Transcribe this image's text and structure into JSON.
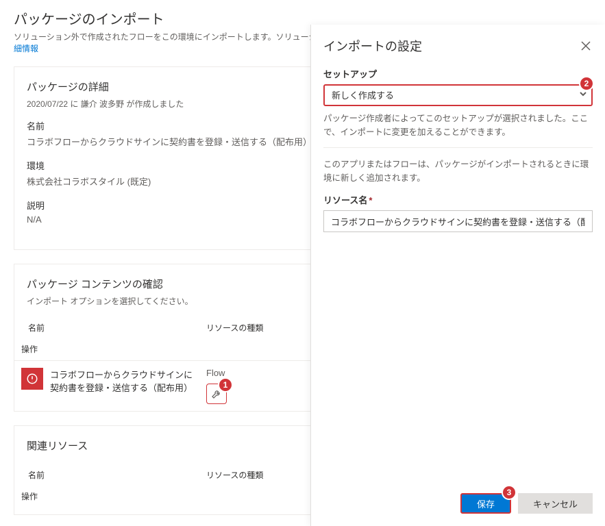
{
  "page": {
    "title": "パッケージのインポート",
    "subtitle_prefix": "ソリューション外で作成されたフローをこの環境にインポートします。ソリューションで作成されたフローは、ソリューションとしてインポートできます。",
    "subtitle_link": "詳細情報"
  },
  "details": {
    "heading": "パッケージの詳細",
    "created": "2020/07/22 に 謙介 波多野 が作成しました",
    "name_label": "名前",
    "name_value": "コラボフローからクラウドサインに契約書を登録・送信する（配布用）",
    "env_label": "環境",
    "env_value": "株式会社コラボスタイル (既定)",
    "desc_label": "説明",
    "desc_value": "N/A"
  },
  "contents": {
    "heading": "パッケージ コンテンツの確認",
    "hint": "インポート オプションを選択してください。",
    "col_name": "名前",
    "col_type": "リソースの種類",
    "col_action": "操作",
    "row": {
      "name": "コラボフローからクラウドサインに契約書を登録・送信する（配布用）",
      "type": "Flow"
    }
  },
  "related": {
    "heading": "関連リソース",
    "col_name": "名前",
    "col_type": "リソースの種類",
    "col_action": "操作"
  },
  "panel": {
    "title": "インポートの設定",
    "setup_label": "セットアップ",
    "setup_value": "新しく作成する",
    "setup_hint": "パッケージ作成者によってこのセットアップが選択されました。ここで、インポートに変更を加えることができます。",
    "scope_hint": "このアプリまたはフローは、パッケージがインポートされるときに環境に新しく追加されます。",
    "resource_label": "リソース名",
    "resource_value": "コラボフローからクラウドサインに契約書を登録・送信する（配布用",
    "save": "保存",
    "cancel": "キャンセル"
  },
  "badges": {
    "b1": "1",
    "b2": "2",
    "b3": "3"
  }
}
